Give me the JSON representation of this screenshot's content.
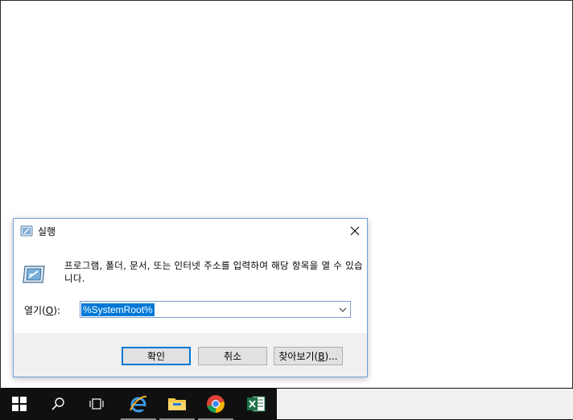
{
  "dialog": {
    "title": "실행",
    "description": "프로그램, 폴더, 문서, 또는 인터넷 주소를 입력하여 해당 항목을 열 수 있습니다.",
    "open_label_prefix": "열기(",
    "open_label_key": "O",
    "open_label_suffix": "):",
    "open_value": "%SystemRoot%",
    "ok_label": "확인",
    "cancel_label": "취소",
    "browse_label_prefix": "찾아보기(",
    "browse_label_key": "B",
    "browse_label_suffix": ")..."
  },
  "taskbar": {
    "items": [
      {
        "icon": "windows-start-icon"
      },
      {
        "icon": "search-icon"
      },
      {
        "icon": "task-view-icon"
      },
      {
        "icon": "internet-explorer-icon"
      },
      {
        "icon": "file-explorer-icon"
      },
      {
        "icon": "chrome-icon"
      },
      {
        "icon": "excel-icon"
      }
    ]
  },
  "colors": {
    "accent": "#0078d7",
    "taskbar": "#101010",
    "footer": "#f0f0f0"
  }
}
